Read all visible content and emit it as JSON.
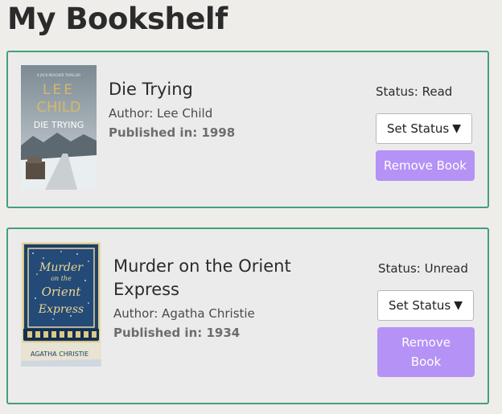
{
  "page": {
    "title": "My Bookshelf"
  },
  "books": [
    {
      "title": "Die Trying",
      "author": "Author: Lee Child",
      "published_label": "Published in:",
      "published_year": "1998",
      "status": "Status: Read",
      "set_status_label": "Set Status",
      "remove_label": "Remove Book",
      "cover": {
        "series": "A JACK REACHER THRILLER",
        "author_top": "LEE",
        "author_bottom": "CHILD",
        "title": "DIE TRYING"
      }
    },
    {
      "title": "Murder on the Orient Express",
      "author": "Author: Agatha Christie",
      "published_label": "Published in:",
      "published_year": "1934",
      "status": "Status: Unread",
      "set_status_label": "Set Status",
      "remove_label": "Remove Book",
      "cover": {
        "line1": "Murder",
        "line2": "on the",
        "line3": "Orient",
        "line4": "Express",
        "author": "AGATHA CHRISTIE"
      }
    }
  ],
  "colors": {
    "accent_border": "#45a07a",
    "remove_button": "#b592f6",
    "background": "#eeedea"
  },
  "icons": {
    "dropdown": "caret-down-icon"
  }
}
